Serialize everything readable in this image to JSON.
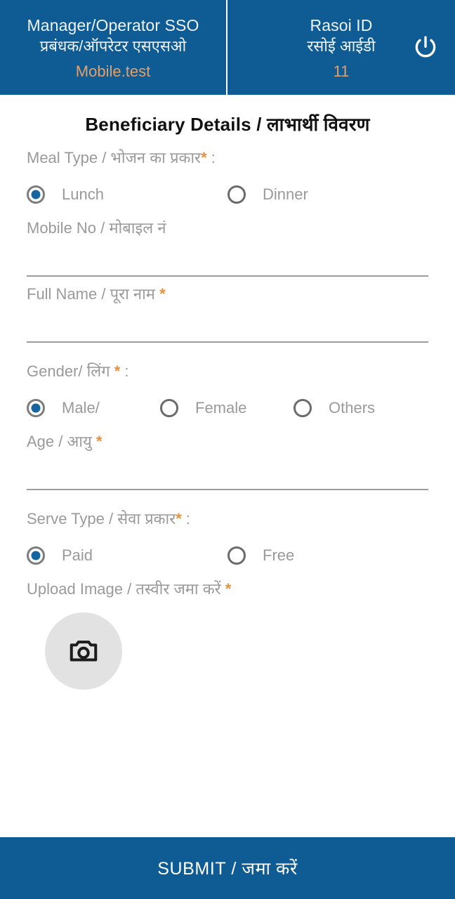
{
  "header": {
    "left": {
      "title_en": "Manager/Operator SSO",
      "title_hi": "प्रबंधक/ऑपरेटर एसएसओ",
      "user": "Mobile.test"
    },
    "right": {
      "title_en": "Rasoi ID",
      "title_hi": "रसोई आईडी",
      "value": "11"
    },
    "power_icon": "power-icon",
    "background_color": "#0F5B94",
    "accent_color": "#E3A06A"
  },
  "page_title": "Beneficiary Details / लाभार्थी विवरण",
  "form": {
    "meal_type": {
      "label": "Meal Type / भोजन का प्रकार",
      "required_mark": "*",
      "suffix": " :",
      "options": [
        {
          "label": "Lunch",
          "selected": true
        },
        {
          "label": "Dinner",
          "selected": false
        }
      ]
    },
    "mobile_no": {
      "label": "Mobile No / मोबाइल नं",
      "required_mark": "",
      "value": "",
      "placeholder": ""
    },
    "full_name": {
      "label": "Full Name / पूरा नाम ",
      "required_mark": "*",
      "value": "",
      "placeholder": ""
    },
    "gender": {
      "label": "Gender/ लिंग ",
      "required_mark": "*",
      "suffix": " :",
      "options": [
        {
          "label": "Male/",
          "selected": true
        },
        {
          "label": "Female",
          "selected": false
        },
        {
          "label": "Others",
          "selected": false
        }
      ]
    },
    "age": {
      "label": "Age / आयु ",
      "required_mark": "*",
      "value": "",
      "placeholder": ""
    },
    "serve_type": {
      "label": "Serve Type / सेवा प्रकार",
      "required_mark": "*",
      "suffix": " :",
      "options": [
        {
          "label": "Paid",
          "selected": true
        },
        {
          "label": "Free",
          "selected": false
        }
      ]
    },
    "upload_image": {
      "label": "Upload Image / तस्वीर जमा करें ",
      "required_mark": "*",
      "icon": "camera-icon"
    }
  },
  "submit": {
    "label": "SUBMIT / जमा करें"
  },
  "colors": {
    "brand_blue": "#0F5B94",
    "accent_orange": "#E3A06A",
    "required_orange": "#E8903E",
    "label_grey": "#9a9a9a",
    "rule_grey": "#9c9c9c",
    "radio_selected": "#1565A0"
  }
}
